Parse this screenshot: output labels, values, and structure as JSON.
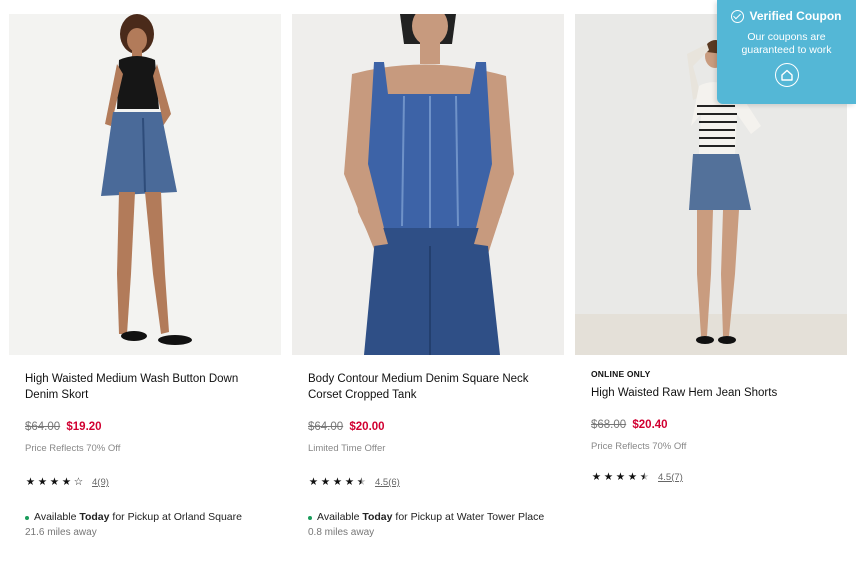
{
  "products": [
    {
      "badge": "",
      "title": "High Waisted Medium Wash Button Down Denim Skort",
      "original_price": "$64.00",
      "sale_price": "$19.20",
      "note": "Price Reflects 70% Off",
      "rating_value": 4,
      "rating_link": "4(9)",
      "pickup_prefix": "Available ",
      "pickup_today": "Today",
      "pickup_suffix": " for Pickup at Orland Square",
      "distance": "21.6 miles away"
    },
    {
      "badge": "",
      "title": "Body Contour Medium Denim Square Neck Corset Cropped Tank",
      "original_price": "$64.00",
      "sale_price": "$20.00",
      "note": "Limited Time Offer",
      "rating_value": 4.5,
      "rating_link": "4.5(6)",
      "pickup_prefix": "Available ",
      "pickup_today": "Today",
      "pickup_suffix": " for Pickup at Water Tower Place",
      "distance": "0.8 miles away"
    },
    {
      "badge": "ONLINE ONLY",
      "title": "High Waisted Raw Hem Jean Shorts",
      "original_price": "$68.00",
      "sale_price": "$20.40",
      "note": "Price Reflects 70% Off",
      "rating_value": 4.5,
      "rating_link": "4.5(7)"
    }
  ],
  "coupon": {
    "title": "Verified Coupon",
    "text": "Our coupons are guaranteed to work",
    "icon": "home-icon",
    "background": "#54b7d6"
  },
  "colors": {
    "sale": "#d10031",
    "availability_dot": "#1a9c5b"
  }
}
